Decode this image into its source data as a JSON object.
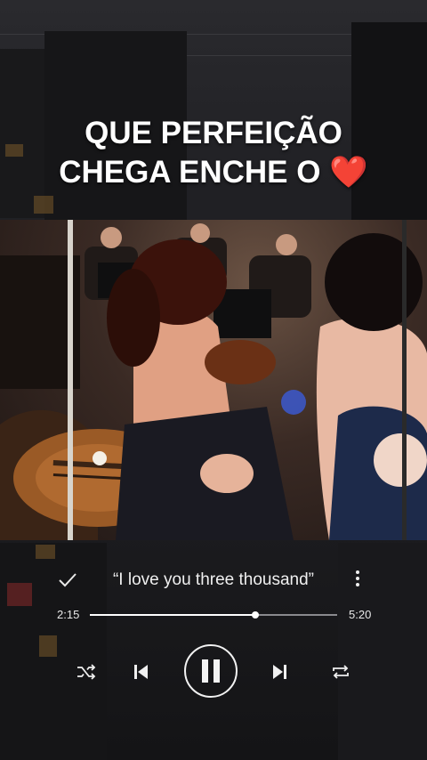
{
  "overlay": {
    "line1": "QUE PERFEIÇÃO",
    "line2": "CHEGA ENCHE O",
    "heart": "❤️"
  },
  "player": {
    "song_title": "“I love you three thousand”",
    "current_time": "2:15",
    "total_time": "5:20",
    "progress_fraction": 0.67,
    "icons": {
      "favorite": "check-icon",
      "menu": "more-vertical-icon",
      "shuffle": "shuffle-icon",
      "previous": "skip-previous-icon",
      "play_state": "pause-icon",
      "next": "skip-next-icon",
      "repeat": "repeat-icon"
    }
  },
  "colors": {
    "heart": "#e22b2b",
    "progress_fill": "#ffffff",
    "progress_track": "#8a8a8e"
  }
}
